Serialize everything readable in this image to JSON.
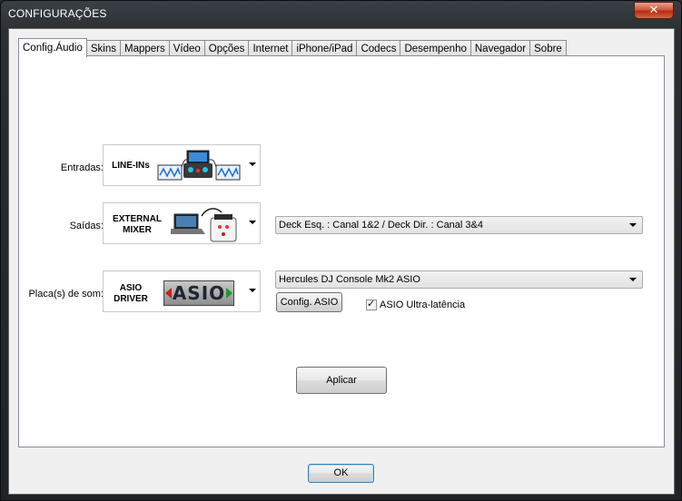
{
  "window": {
    "title": "CONFIGURAÇÕES",
    "close_label": "✕"
  },
  "tabs": [
    {
      "label": "Config.Áudio",
      "active": true
    },
    {
      "label": "Skins"
    },
    {
      "label": "Mappers"
    },
    {
      "label": "Vídeo"
    },
    {
      "label": "Opções"
    },
    {
      "label": "Internet"
    },
    {
      "label": "iPhone/iPad"
    },
    {
      "label": "Codecs"
    },
    {
      "label": "Desempenho"
    },
    {
      "label": "Navegador"
    },
    {
      "label": "Sobre"
    }
  ],
  "inputs": {
    "label": "Entradas:",
    "device_text": "LINE-INs"
  },
  "outputs": {
    "label": "Saídas:",
    "device_line1": "EXTERNAL",
    "device_line2": "MIXER",
    "routing_value": "Deck Esq. : Canal 1&2 / Deck Dir. : Canal 3&4"
  },
  "soundcard": {
    "label": "Placa(s) de som:",
    "device_line1": "ASIO",
    "device_line2": "DRIVER",
    "logo_text": "ASIO",
    "card_value": "Hercules DJ Console Mk2 ASIO",
    "config_button": "Config. ASIO",
    "ultra_latency_label": "ASIO Ultra-latência",
    "ultra_latency_checked": true
  },
  "apply_button": "Aplicar",
  "ok_button": "OK"
}
